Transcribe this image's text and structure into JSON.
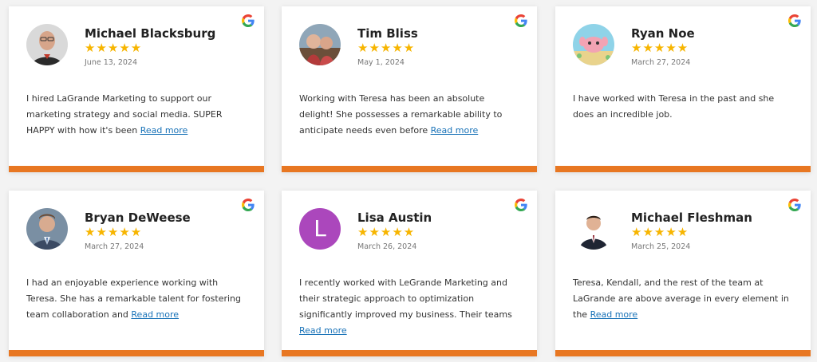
{
  "colors": {
    "accent": "#e87722",
    "star": "#f7b500",
    "link": "#1a73b8",
    "avatar_letter_bg": "#ab47bc"
  },
  "review_source_icon": "google-g-icon",
  "rating_stars": "★★★★★",
  "read_more_label": "Read more",
  "reviews": [
    {
      "name": "Michael Blacksburg",
      "date": "June 13, 2024",
      "rating": 5,
      "avatar": "photo",
      "text": "I hired LaGrande Marketing to support our marketing strategy and social media. SUPER HAPPY with how it's been"
    },
    {
      "name": "Tim Bliss",
      "date": "May 1, 2024",
      "rating": 5,
      "avatar": "photo",
      "text": "Working with Teresa has been an absolute delight! She possesses a remarkable ability to anticipate needs even before"
    },
    {
      "name": "Ryan Noe",
      "date": "March 27, 2024",
      "rating": 5,
      "avatar": "illustration",
      "text": "I have worked with Teresa in the past and she does an incredible job."
    },
    {
      "name": "Bryan DeWeese",
      "date": "March 27, 2024",
      "rating": 5,
      "avatar": "photo",
      "text": "I had an enjoyable experience working with Teresa. She has a remarkable talent for fostering team collaboration and"
    },
    {
      "name": "Lisa Austin",
      "date": "March 26, 2024",
      "rating": 5,
      "avatar": "letter",
      "avatar_letter": "L",
      "text": "I recently worked with LeGrande Marketing and their strategic approach to optimization significantly improved my business. Their teams"
    },
    {
      "name": "Michael Fleshman",
      "date": "March 25, 2024",
      "rating": 5,
      "avatar": "photo",
      "text": "Teresa, Kendall, and the rest of the team at LaGrande are above average in every element in the"
    }
  ]
}
